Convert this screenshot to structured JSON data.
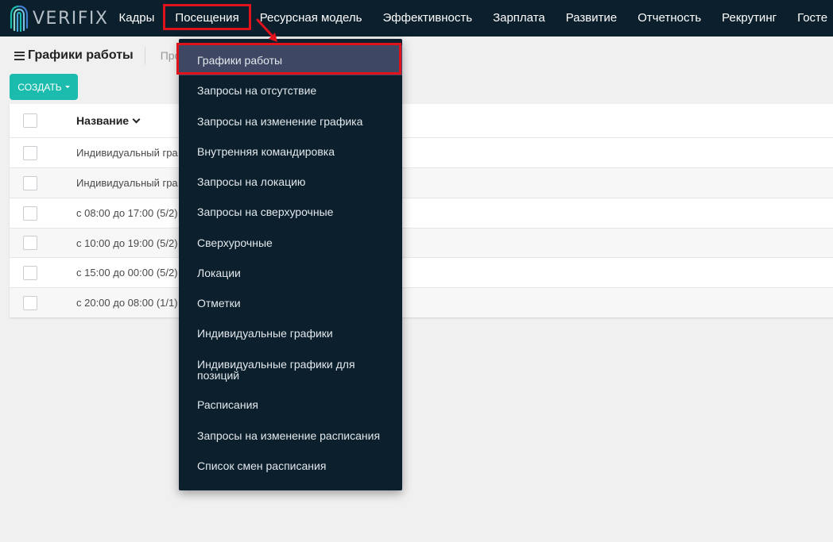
{
  "brand": {
    "name": "VERIFIX"
  },
  "nav": {
    "items": [
      "Кадры",
      "Посещения",
      "Ресурсная модель",
      "Эффективность",
      "Зарплата",
      "Развитие",
      "Отчетность",
      "Рекрутинг",
      "Госте"
    ],
    "active_index": 1
  },
  "page": {
    "title": "Графики работы",
    "tab_partial": "Про"
  },
  "toolbar": {
    "create_label": "СОЗДАТЬ"
  },
  "table": {
    "header": "Название",
    "rows": [
      "Индивидуальный гра",
      "Индивидуальный гра",
      "с 08:00 до 17:00 (5/2)",
      "с 10:00 до 19:00 (5/2)",
      "с 15:00 до 00:00 (5/2)",
      "с 20:00 до 08:00 (1/1)"
    ]
  },
  "dropdown": {
    "items": [
      "Графики работы",
      "Запросы на отсутствие",
      "Запросы на изменение графика",
      "Внутренняя командировка",
      "Запросы на локацию",
      "Запросы на сверхурочные",
      "Сверхурочные",
      "Локации",
      "Отметки",
      "Индивидуальные графики",
      "Индивидуальные графики для позиций",
      "Расписания",
      "Запросы на изменение расписания",
      "Список смен расписания"
    ],
    "selected_index": 0
  },
  "colors": {
    "navbar": "#0b1f2c",
    "accent": "#1bbcad",
    "highlight": "#e0131d",
    "selected_item": "#3e4764"
  }
}
